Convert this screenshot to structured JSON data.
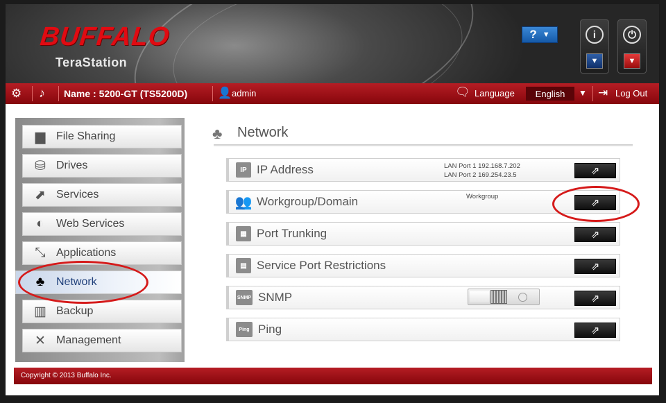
{
  "header": {
    "brand": "BUFFALO",
    "product": "TeraStation",
    "help_label": "?",
    "help_caret": "▼",
    "info_glyph": "i",
    "power_glyph": "⏻",
    "dropdown_caret": "▼"
  },
  "topbar": {
    "device_name": "Name : 5200-GT (TS5200D)",
    "user": "admin",
    "language_label": "Language",
    "language_value": "English",
    "language_caret": "▼",
    "logout_label": "Log Out"
  },
  "sidebar": {
    "items": [
      {
        "label": "File Sharing",
        "icon": "folder-icon",
        "glyph": "▆"
      },
      {
        "label": "Drives",
        "icon": "drive-icon",
        "glyph": "⛁"
      },
      {
        "label": "Services",
        "icon": "services-icon",
        "glyph": "⬈"
      },
      {
        "label": "Web Services",
        "icon": "web-services-icon",
        "glyph": "◐"
      },
      {
        "label": "Applications",
        "icon": "applications-icon",
        "glyph": "⤡"
      },
      {
        "label": "Network",
        "icon": "network-icon",
        "glyph": "♣",
        "active": true
      },
      {
        "label": "Backup",
        "icon": "backup-icon",
        "glyph": "▥"
      },
      {
        "label": "Management",
        "icon": "management-icon",
        "glyph": "✕"
      }
    ]
  },
  "panel": {
    "title": "Network",
    "title_glyph": "♣",
    "rows": [
      {
        "label": "IP Address",
        "icon": "ip-icon",
        "glyph": "IP",
        "info": [
          "LAN Port 1 192.168.7.202",
          "LAN Port 2 169.254.23.5"
        ]
      },
      {
        "label": "Workgroup/Domain",
        "icon": "workgroup-icon",
        "glyph": "👥",
        "info": [
          "Workgroup"
        ]
      },
      {
        "label": "Port Trunking",
        "icon": "port-trunking-icon",
        "glyph": "▦"
      },
      {
        "label": "Service Port Restrictions",
        "icon": "service-port-icon",
        "glyph": "▤"
      },
      {
        "label": "SNMP",
        "icon": "snmp-icon",
        "glyph": "SNMP",
        "toggle_on": false
      },
      {
        "label": "Ping",
        "icon": "ping-icon",
        "glyph": "Ping"
      }
    ],
    "open_glyph": "⇗"
  },
  "footer": {
    "copyright": "Copyright © 2013 Buffalo Inc."
  },
  "colors": {
    "brand_red": "#e10b12",
    "bar_red": "#a1121a",
    "annotation_red": "#d51a1a",
    "help_blue": "#2a72c4"
  }
}
